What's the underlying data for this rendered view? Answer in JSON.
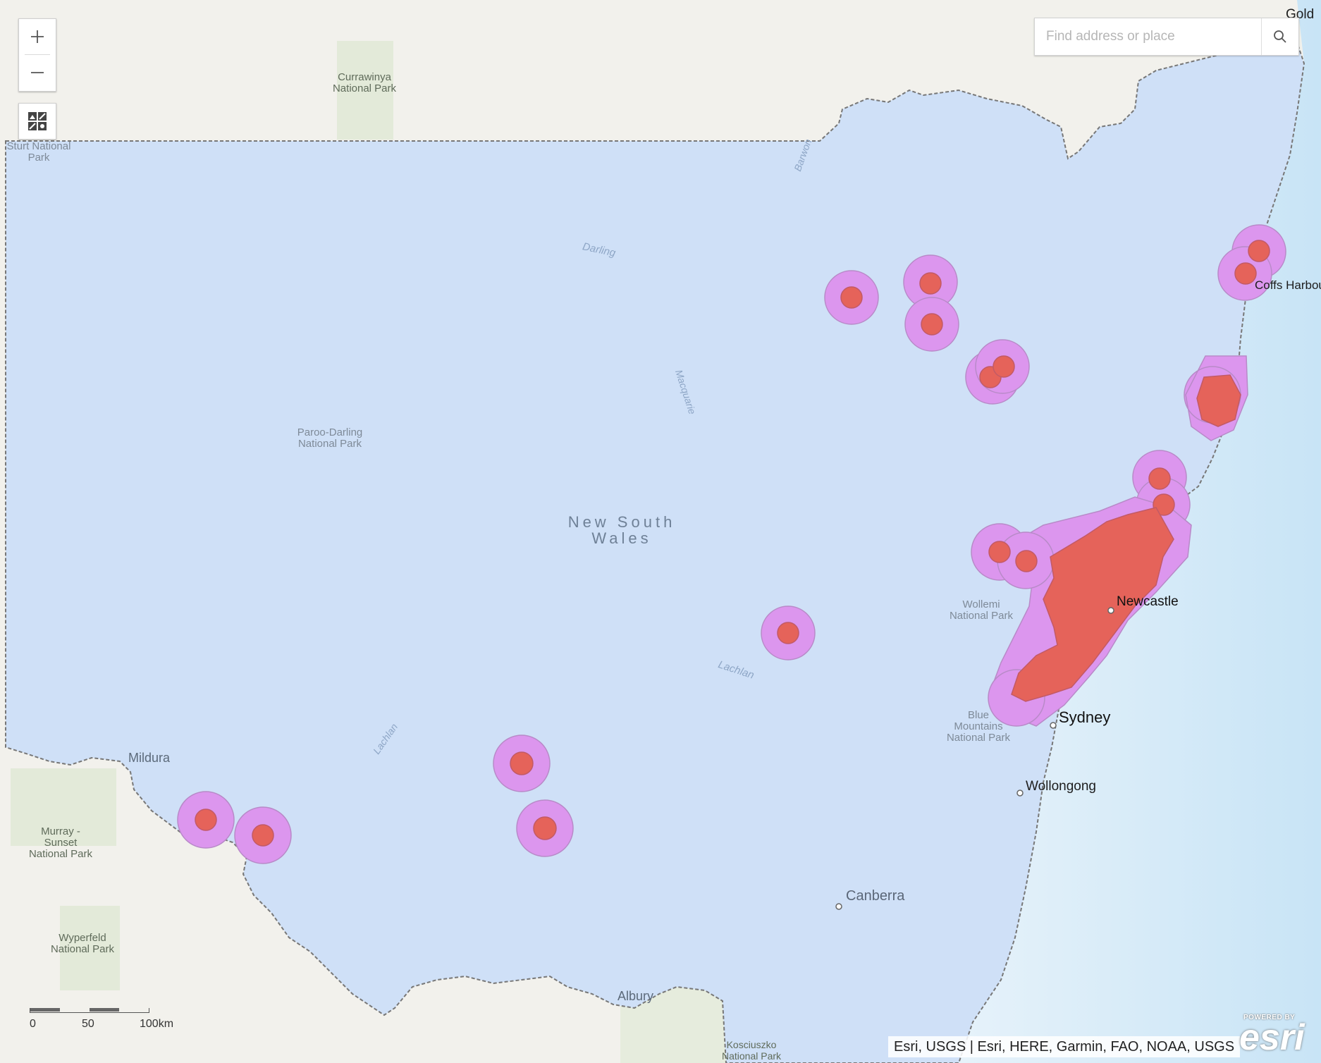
{
  "map": {
    "search": {
      "placeholder": "Find address or place"
    },
    "zoom": {
      "in_symbol": "+",
      "out_symbol": "−"
    },
    "state_label": [
      "New South",
      "Wales"
    ],
    "cities": {
      "gold": "Gold",
      "coffs": "Coffs Harbour",
      "newcastle": "Newcastle",
      "sydney": "Sydney",
      "wollongong": "Wollongong",
      "canberra": "Canberra",
      "mildura": "Mildura",
      "albury": "Albury"
    },
    "parks": {
      "currawinya": [
        "Currawinya",
        "National Park"
      ],
      "sturt": [
        "Sturt National",
        "Park"
      ],
      "paroo": [
        "Paroo-Darling",
        "National Park"
      ],
      "wollemi": [
        "Wollemi",
        "National Park"
      ],
      "blue_mountains": [
        "Blue",
        "Mountains",
        "National Park"
      ],
      "murray_sunset": [
        "Murray -",
        "Sunset",
        "National Park"
      ],
      "wyperfeld": [
        "Wyperfeld",
        "National Park"
      ],
      "kosciuszko": [
        "Kosciuszko",
        "National Park"
      ]
    },
    "rivers": {
      "darling": "Darling",
      "barwon": "Barwon",
      "macquarie": "Macquarie",
      "lachlan_east": "Lachlan",
      "lachlan_west": "Lachlan"
    },
    "scale": {
      "labels": [
        "0",
        "50",
        "100km"
      ]
    },
    "attribution": "Esri, USGS | Esri, HERE, Garmin, FAO, NOAA, USGS",
    "esri_logo": {
      "powered_by": "POWERED BY",
      "name": "esri"
    },
    "colors": {
      "state_fill": "#cfe0f7",
      "buffer_fill": "#dc96ee",
      "point_fill": "#e5635a",
      "ocean": "#d8ecf7"
    },
    "icons": [
      "plus-icon",
      "minus-icon",
      "basemap-gallery-icon",
      "search-icon"
    ]
  }
}
